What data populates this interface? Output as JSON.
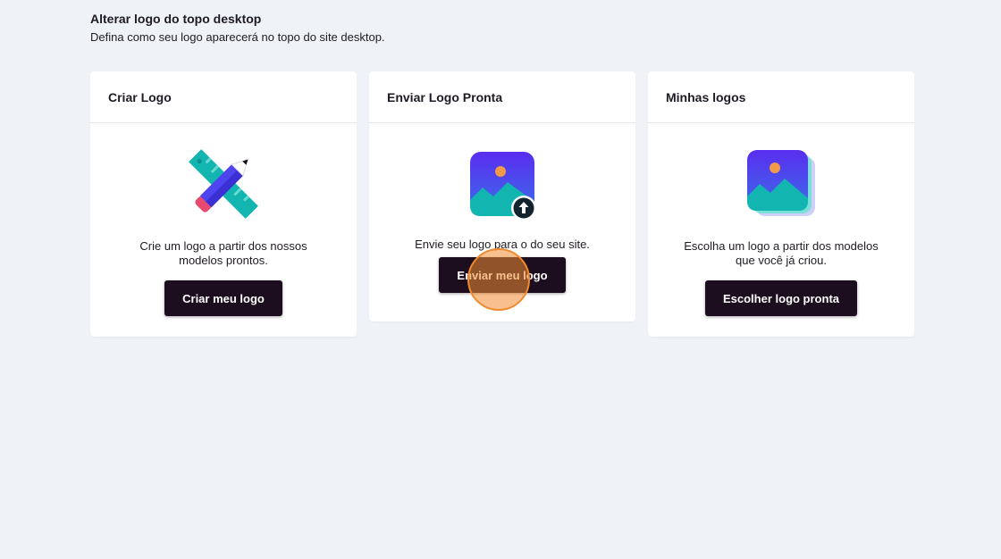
{
  "header": {
    "title": "Alterar logo do topo desktop",
    "subtitle": "Defina como seu logo aparecerá no topo do site desktop."
  },
  "cards": [
    {
      "title": "Criar Logo",
      "icon": "pencil-ruler-icon",
      "description": "Crie um logo a partir dos nossos modelos prontos.",
      "button": "Criar meu logo"
    },
    {
      "title": "Enviar Logo Pronta",
      "icon": "image-upload-icon",
      "description": "Envie seu logo para o do seu site.",
      "button": "Enviar meu logo"
    },
    {
      "title": "Minhas logos",
      "icon": "image-stack-icon",
      "description": "Escolha um logo a partir dos modelos que você já criou.",
      "button": "Escolher logo pronta"
    }
  ],
  "colors": {
    "page_background": "#eff3f8",
    "button_background": "#1d0e1f",
    "click_indicator": "#f08a2e"
  }
}
